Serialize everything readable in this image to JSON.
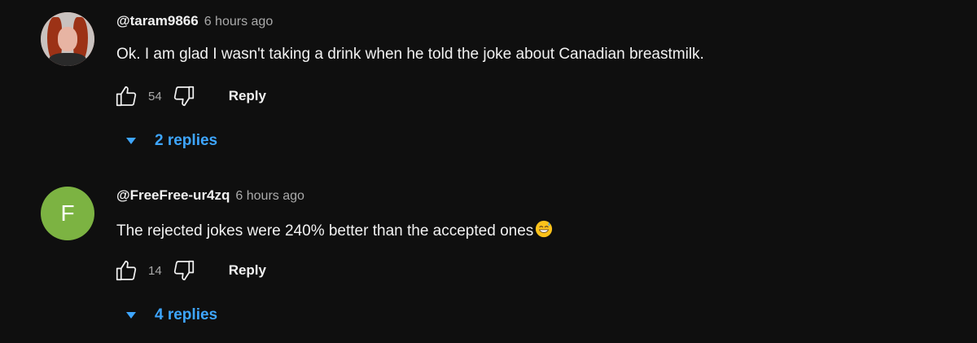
{
  "comments": [
    {
      "handle": "@taram9866",
      "time": "6 hours ago",
      "text": "Ok. I am glad I wasn't taking a drink when he told the joke about Canadian breastmilk.",
      "likes": "54",
      "reply_label": "Reply",
      "replies_label": "2 replies",
      "avatar": "profile-photo"
    },
    {
      "handle": "@FreeFree-ur4zq",
      "time": "6 hours ago",
      "text": "The rejected jokes were 240% better than the accepted ones",
      "emoji": "grinning-face-with-sweat",
      "likes": "14",
      "reply_label": "Reply",
      "replies_label": "4 replies",
      "avatar_letter": "F",
      "avatar_color": "#7cb342"
    }
  ],
  "colors": {
    "background": "#0f0f0f",
    "text": "#f1f1f1",
    "muted": "#aaaaaa",
    "link": "#3ea6ff"
  },
  "icons": [
    "like-icon",
    "dislike-icon",
    "caret-down-icon"
  ]
}
